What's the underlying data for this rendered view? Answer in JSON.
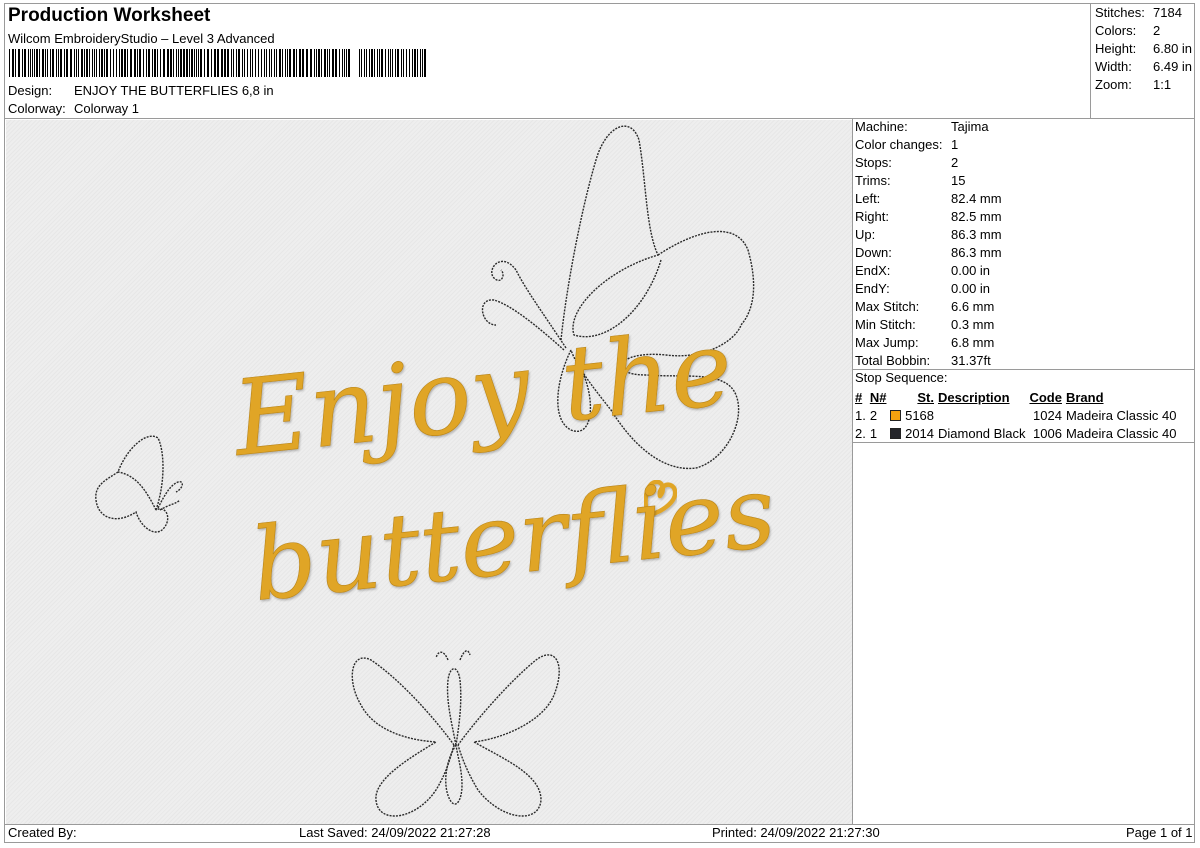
{
  "header": {
    "title": "Production Worksheet",
    "software": "Wilcom EmbroideryStudio – Level 3 Advanced",
    "design_label": "Design:",
    "design_value": "ENJOY THE BUTTERFLIES 6,8 in",
    "colorway_label": "Colorway:",
    "colorway_value": "Colorway 1"
  },
  "top_stats": [
    {
      "label": "Stitches:",
      "value": "7184"
    },
    {
      "label": "Colors:",
      "value": "2"
    },
    {
      "label": "Height:",
      "value": "6.80 in"
    },
    {
      "label": "Width:",
      "value": "6.49 in"
    },
    {
      "label": "Zoom:",
      "value": "1:1"
    }
  ],
  "specs": [
    {
      "label": "Machine:",
      "value": "Tajima"
    },
    {
      "label": "Color changes:",
      "value": "1"
    },
    {
      "label": "Stops:",
      "value": "2"
    },
    {
      "label": "Trims:",
      "value": "15"
    },
    {
      "label": "Left:",
      "value": "82.4 mm"
    },
    {
      "label": "Right:",
      "value": "82.5 mm"
    },
    {
      "label": "Up:",
      "value": "86.3 mm"
    },
    {
      "label": "Down:",
      "value": "86.3 mm"
    },
    {
      "label": "EndX:",
      "value": "0.00 in"
    },
    {
      "label": "EndY:",
      "value": "0.00 in"
    },
    {
      "label": "Max Stitch:",
      "value": "6.6 mm"
    },
    {
      "label": "Min Stitch:",
      "value": "0.3 mm"
    },
    {
      "label": "Max Jump:",
      "value": "6.8 mm"
    },
    {
      "label": "Total Bobbin:",
      "value": "31.37ft"
    }
  ],
  "stop_sequence": {
    "title": "Stop Sequence:",
    "headers": {
      "num": "#",
      "n": "N#",
      "st": "St.",
      "description": "Description",
      "code": "Code",
      "brand": "Brand"
    },
    "rows": [
      {
        "num": "1.",
        "n": "2",
        "color": "#f5a20f",
        "st": "5168",
        "description": "",
        "code": "1024",
        "brand": "Madeira Classic 40"
      },
      {
        "num": "2.",
        "n": "1",
        "color": "#24252a",
        "st": "2014",
        "description": "Diamond Black",
        "code": "1006",
        "brand": "Madeira Classic 40"
      }
    ]
  },
  "design": {
    "text_lines": [
      "Enjoy the",
      "butterflies"
    ],
    "thread_gold": "#e0a526",
    "thread_black": "#2a2a2a"
  },
  "footer": {
    "created_by": "Created By:",
    "last_saved": "Last Saved: 24/09/2022 21:27:28",
    "printed": "Printed: 24/09/2022 21:27:30",
    "page": "Page 1 of 1"
  }
}
